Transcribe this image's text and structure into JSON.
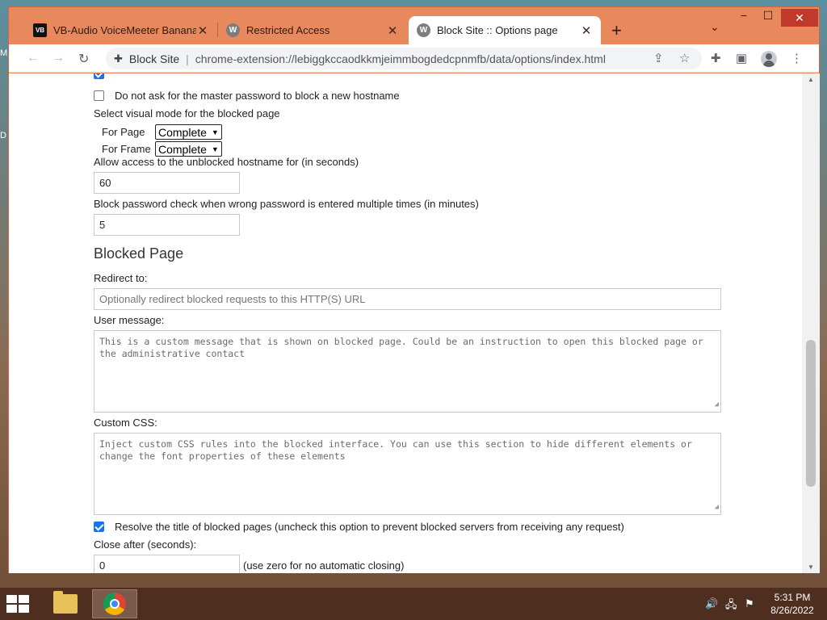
{
  "desktop": {
    "edge_letters": [
      "M",
      "D"
    ]
  },
  "tabs": [
    {
      "label": "VB-Audio VoiceMeeter Banana",
      "favicon": "VB",
      "active": false
    },
    {
      "label": "Restricted Access",
      "favicon": "W",
      "active": false
    },
    {
      "label": "Block Site :: Options page",
      "favicon": "W",
      "active": true
    }
  ],
  "window_controls": {
    "minimize": "−",
    "maximize": "☐",
    "close": "✕"
  },
  "toolbar": {
    "site_name": "Block Site",
    "url": "chrome-extension://lebiggkccaodkkmjeimmbogdedcpnmfb/data/options/index.html"
  },
  "options": {
    "master_password_checkbox": {
      "label": "Do not ask for the master password to block a new hostname",
      "checked": false
    },
    "visual_mode_label": "Select visual mode for the blocked page",
    "for_page_label": "For Page",
    "for_page_value": "Complete",
    "for_frame_label": "For Frame",
    "for_frame_value": "Complete",
    "allow_access_label": "Allow access to the unblocked hostname for (in seconds)",
    "allow_access_value": "60",
    "block_password_label": "Block password check when wrong password is entered multiple times (in minutes)",
    "block_password_value": "5"
  },
  "blocked_page": {
    "heading": "Blocked Page",
    "redirect_label": "Redirect to:",
    "redirect_placeholder": "Optionally redirect blocked requests to this HTTP(S) URL",
    "user_message_label": "User message:",
    "user_message_placeholder": "This is a custom message that is shown on blocked page. Could be an instruction to open this blocked page or the administrative contact",
    "custom_css_label": "Custom CSS:",
    "custom_css_placeholder": "Inject custom CSS rules into the blocked interface. You can use this section to hide different elements or change the font properties of these elements",
    "resolve_title": {
      "label": "Resolve the title of blocked pages (uncheck this option to prevent blocked servers from receiving any request)",
      "checked": true
    },
    "close_after_label": "Close after (seconds):",
    "close_after_value": "0",
    "close_after_hint": "(use zero for no automatic closing)"
  },
  "taskbar": {
    "time": "5:31 PM",
    "date": "8/26/2022"
  }
}
